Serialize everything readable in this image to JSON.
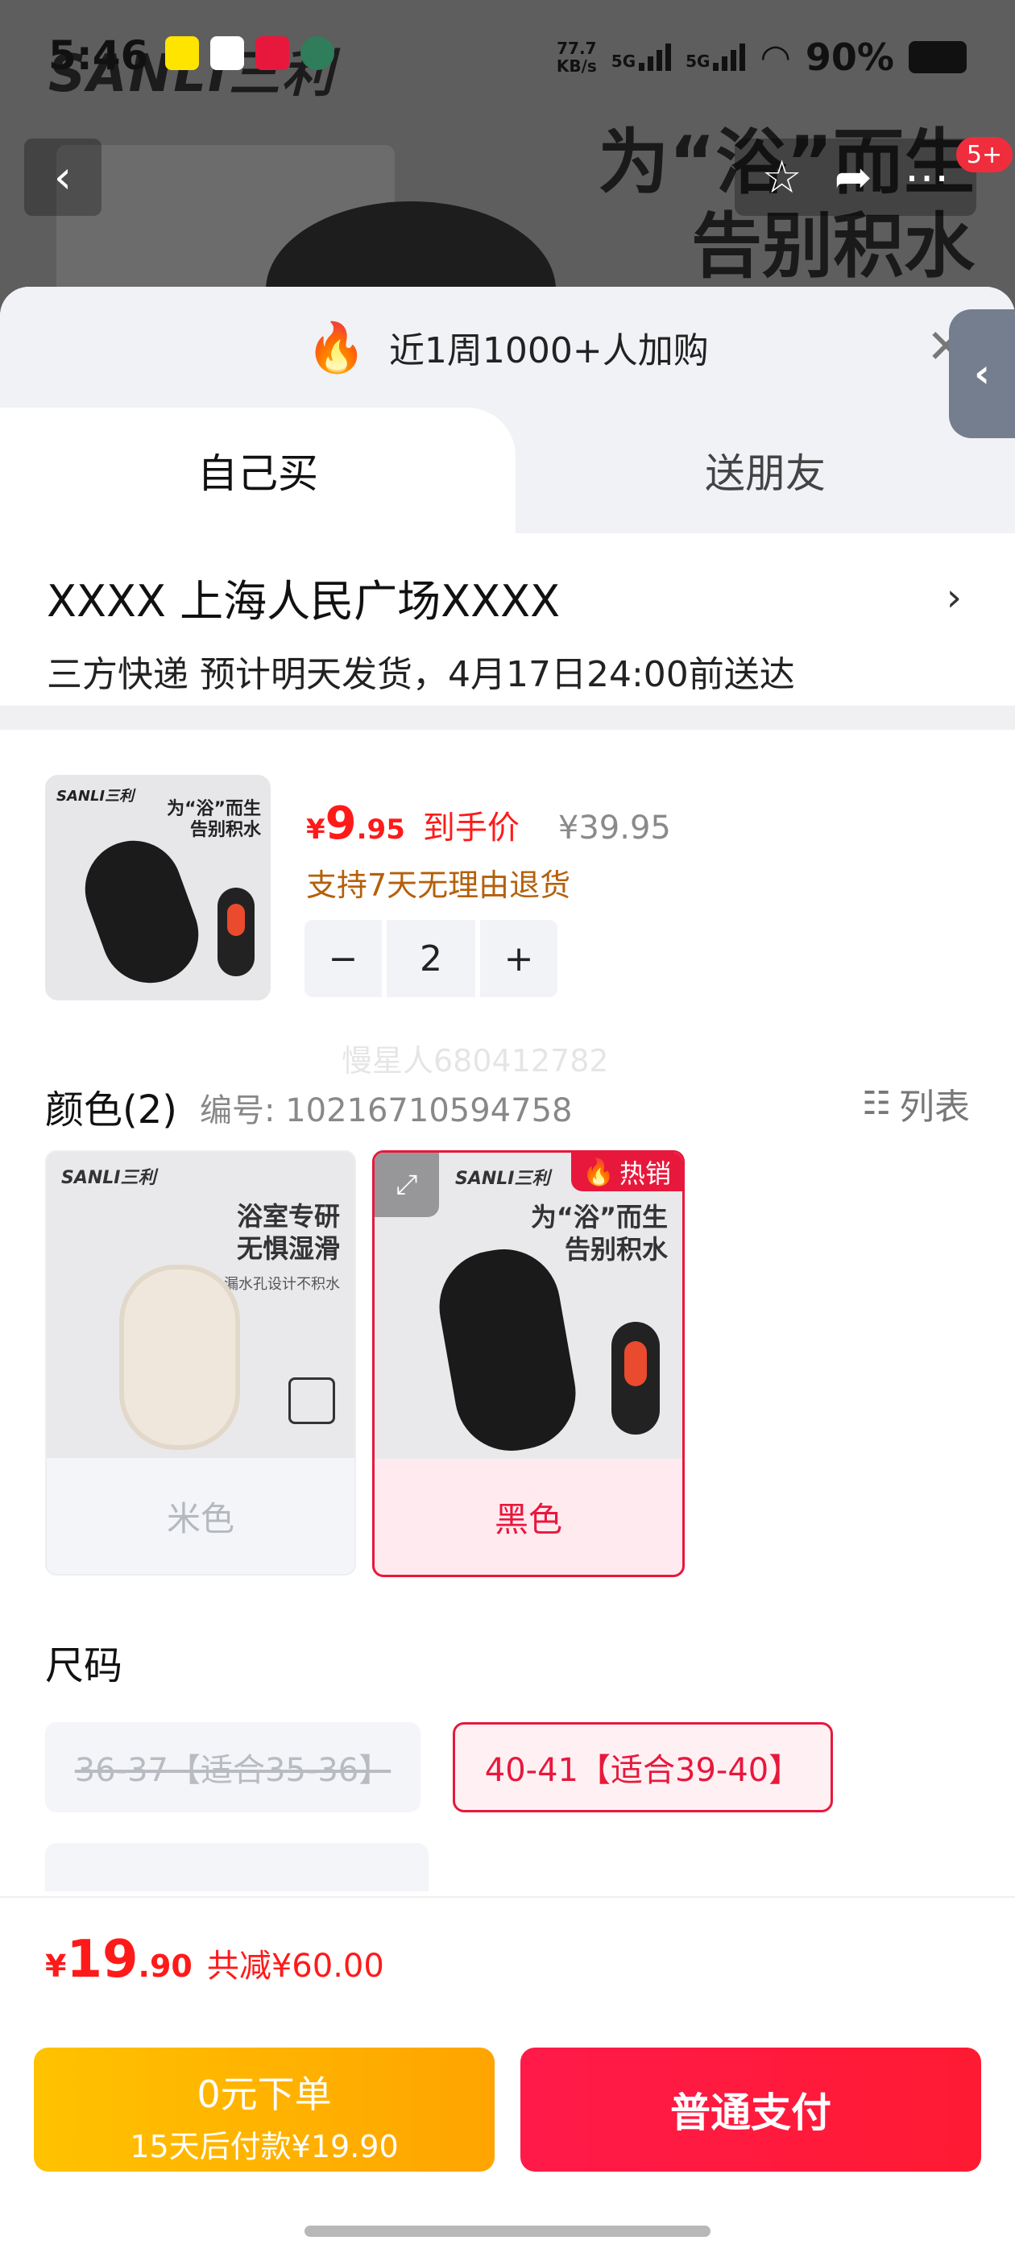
{
  "status_bar": {
    "time": "5:46",
    "net_speed_value": "77.7",
    "net_speed_unit": "KB/s",
    "signal1": "5G",
    "signal2": "5G",
    "battery": "90%"
  },
  "background": {
    "brand": "SANLI三利",
    "headline_line1": "为“浴”而生",
    "headline_line2": "告别积水",
    "cart_badge": "5+"
  },
  "sheet": {
    "buy_count": "近1周1000+人加购",
    "tabs": {
      "self": "自己买",
      "friend": "送朋友"
    },
    "address": "XXXX  上海人民广场XXXX",
    "delivery": "三方快递 预计明天发货，4月17日24:00前送达"
  },
  "product": {
    "thumb_brand": "SANLI三利",
    "thumb_slogan_1": "为“浴”而生",
    "thumb_slogan_2": "告别积水",
    "price_symbol": "¥",
    "price_int": "9",
    "price_dec": ".95",
    "price_tag": "到手价",
    "original_price": "¥39.95",
    "refund": "支持7天无理由退货",
    "quantity": "2",
    "minus": "−",
    "plus": "+",
    "watermark": "慢星人680412782"
  },
  "color": {
    "title": "颜色(2)",
    "sku": "编号: 10216710594758",
    "list_label": "列表",
    "options": [
      {
        "label": "米色",
        "brand": "SANLI三利",
        "slogan_1": "浴室专研",
        "slogan_2": "无惧湿滑",
        "note": "漏水孔设计不积水",
        "selected": false
      },
      {
        "label": "黑色",
        "brand": "SANLI三利",
        "slogan_1": "为“浴”而生",
        "slogan_2": "告别积水",
        "badge": "热销",
        "selected": true
      }
    ]
  },
  "size": {
    "title": "尺码",
    "options": [
      {
        "label": "36-37【适合35-36】",
        "state": "disabled"
      },
      {
        "label": "40-41【适合39-40】",
        "state": "selected"
      }
    ]
  },
  "footer": {
    "total_symbol": "¥",
    "total_int": "19",
    "total_dec": ".90",
    "discount": "共减¥60.00",
    "zero_pay_title": "0元下单",
    "zero_pay_sub": "15天后付款¥19.90",
    "pay_button": "普通支付"
  },
  "colors": {
    "accent_red": "#e8183c",
    "price_red": "#ff1a1a",
    "gold_button": "#ffb300",
    "refund_brown": "#b4600a"
  }
}
